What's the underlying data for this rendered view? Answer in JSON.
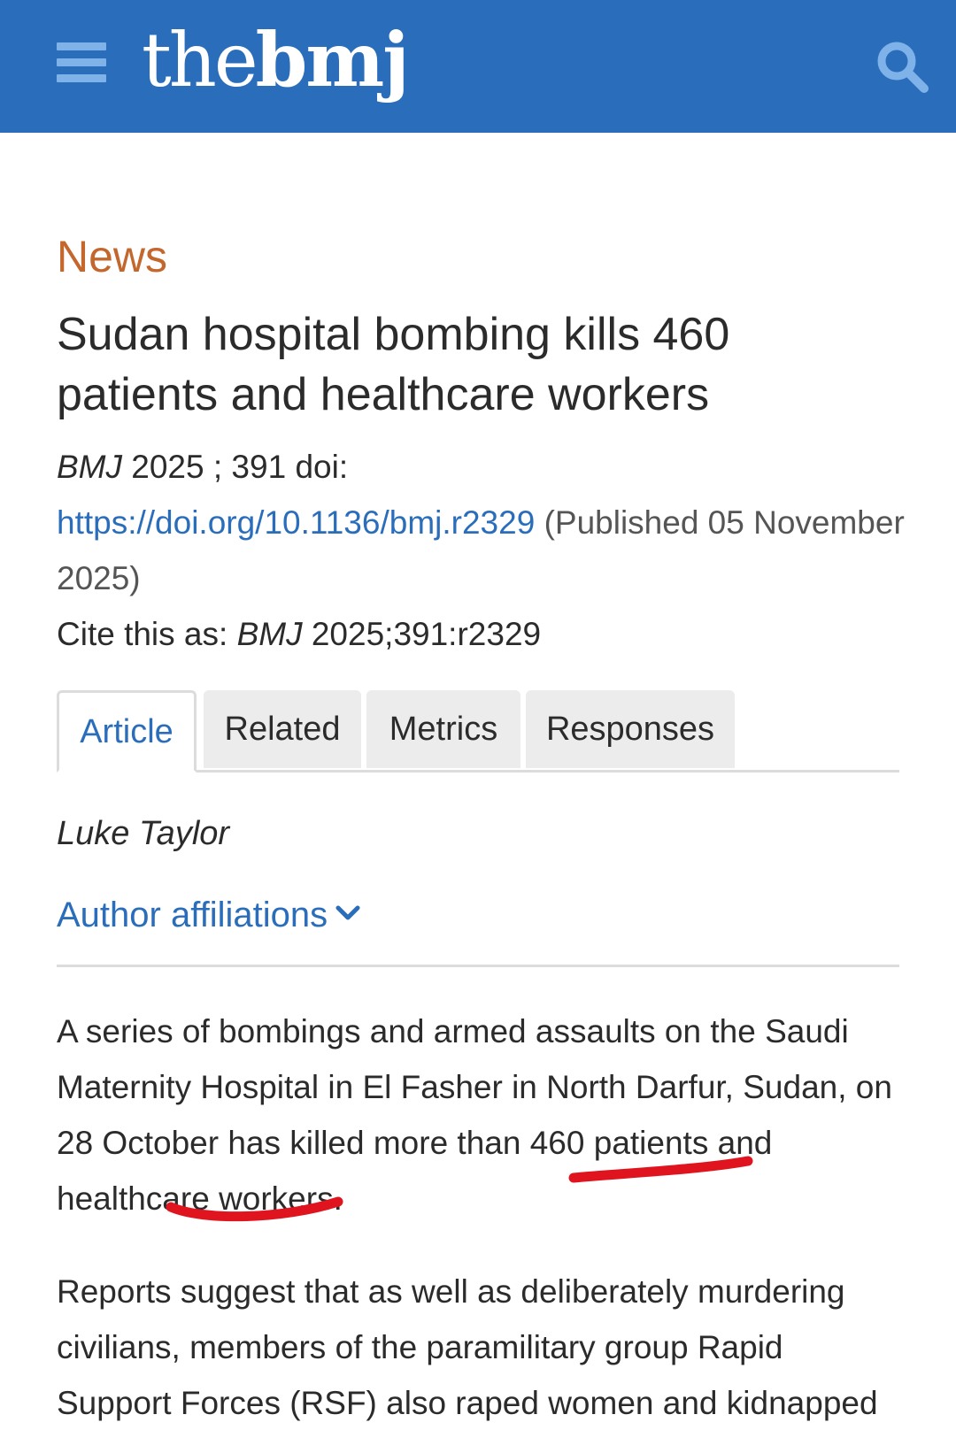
{
  "header": {
    "logo_light": "the",
    "logo_bold": "bmj",
    "colors": {
      "bar": "#2a6ebb",
      "icon": "#7fb2e8"
    }
  },
  "article": {
    "section": "News",
    "title": "Sudan hospital bombing kills 460 patients and healthcare workers",
    "citation": {
      "journal": "BMJ",
      "volume_text": " 2025 ; 391 ",
      "doi_label": " doi: ",
      "doi_url": "https://doi.org/10.1136/bmj.r2329",
      "published": "(Published 05 November 2025)",
      "cite_prefix": "Cite this as: ",
      "cite_journal": "BMJ",
      "cite_suffix": " 2025;391:r2329"
    },
    "tabs": [
      {
        "label": "Article",
        "active": true
      },
      {
        "label": "Related",
        "active": false
      },
      {
        "label": "Metrics",
        "active": false
      },
      {
        "label": "Responses",
        "active": false
      }
    ],
    "author": "Luke Taylor",
    "affiliations_label": "Author affiliations",
    "paragraphs": [
      "A series of bombings and armed assaults on the Saudi Maternity Hospital in El Fasher in North Darfur, Sudan, on 28 October has killed more than 460 patients and healthcare workers.",
      "Reports suggest that as well as deliberately murdering civilians, members of the paramilitary group Rapid Support Forces (RSF) also raped women and kidnapped"
    ],
    "colors": {
      "section": "#c4672d",
      "link": "#2a6ebb",
      "annotation": "#e0141e"
    }
  }
}
